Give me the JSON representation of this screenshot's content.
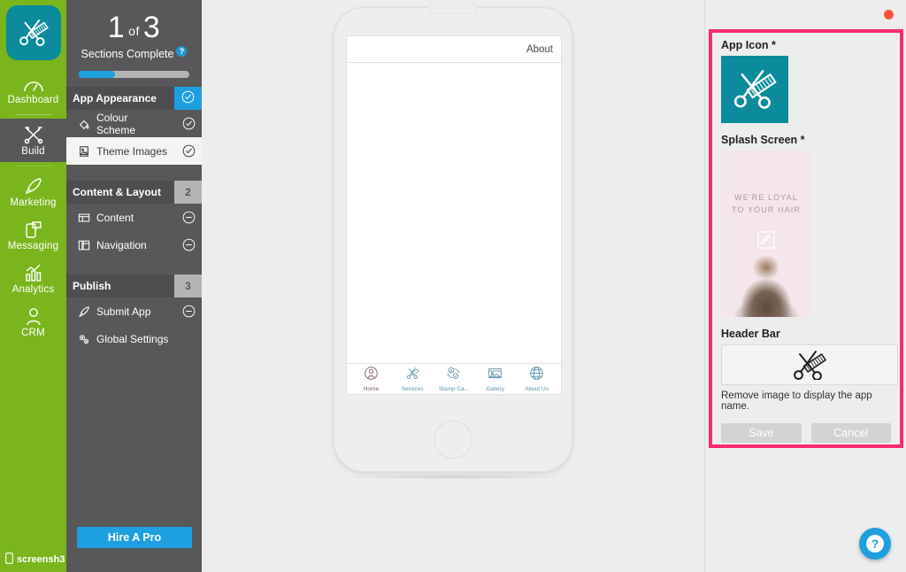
{
  "rail": {
    "logo_icon": "scissors-comb-logo",
    "items": [
      {
        "id": "dashboard",
        "label": "Dashboard",
        "icon": "gauge-icon",
        "active": false
      },
      {
        "id": "build",
        "label": "Build",
        "icon": "tools-icon",
        "active": true
      },
      {
        "id": "marketing",
        "label": "Marketing",
        "icon": "rocket-icon",
        "active": false
      },
      {
        "id": "messaging",
        "label": "Messaging",
        "icon": "chat-phone-icon",
        "active": false
      },
      {
        "id": "analytics",
        "label": "Analytics",
        "icon": "bar-chart-icon",
        "active": false
      },
      {
        "id": "crm",
        "label": "CRM",
        "icon": "person-icon",
        "active": false
      }
    ],
    "footer": {
      "label": "screensh3",
      "icon": "mobile-icon"
    }
  },
  "panel": {
    "progress": {
      "current": "1",
      "of": "of",
      "total": "3",
      "label": "Sections Complete",
      "help_icon": "question-mark-icon",
      "percent": 33
    },
    "groups": [
      {
        "id": "app-appearance",
        "title": "App Appearance",
        "badge": "✓",
        "badge_type": "done",
        "items": [
          {
            "id": "colour-scheme",
            "label": "Colour Scheme",
            "icon": "paint-drop-icon",
            "state": "check-circle-icon",
            "selected": false
          },
          {
            "id": "theme-images",
            "label": "Theme Images",
            "icon": "image-icon",
            "state": "check-circle-icon",
            "selected": true
          }
        ]
      },
      {
        "id": "content-layout",
        "title": "Content & Layout",
        "badge": "2",
        "badge_type": "num",
        "items": [
          {
            "id": "content",
            "label": "Content",
            "icon": "layout-icon",
            "state": "minus-circle-icon",
            "selected": false
          },
          {
            "id": "navigation",
            "label": "Navigation",
            "icon": "columns-icon",
            "state": "minus-circle-icon",
            "selected": false
          }
        ]
      },
      {
        "id": "publish",
        "title": "Publish",
        "badge": "3",
        "badge_type": "num",
        "items": [
          {
            "id": "submit-app",
            "label": "Submit App",
            "icon": "rocket-icon",
            "state": "minus-circle-icon",
            "selected": false
          },
          {
            "id": "global-settings",
            "label": "Global Settings",
            "icon": "gears-icon",
            "state": "",
            "selected": false
          }
        ]
      }
    ],
    "hire_a_pro": "Hire A Pro"
  },
  "preview": {
    "header_title": "About",
    "tabs": [
      {
        "id": "home",
        "label": "Home",
        "icon": "person-circle-icon",
        "active": true
      },
      {
        "id": "services",
        "label": "Services",
        "icon": "scissors-comb-icon",
        "active": false
      },
      {
        "id": "stamp-card",
        "label": "Stamp Ca...",
        "icon": "stamp-card-icon",
        "active": false
      },
      {
        "id": "gallery",
        "label": "Gallery",
        "icon": "photo-icon",
        "active": false
      },
      {
        "id": "about-us",
        "label": "About Us",
        "icon": "globe-icon",
        "active": false
      }
    ]
  },
  "properties": {
    "rec_dot": "recording-indicator",
    "app_icon": {
      "label": "App Icon *",
      "icon": "scissors-comb-icon",
      "bg_color": "#0b8b9b"
    },
    "splash": {
      "label": "Splash Screen *",
      "line1": "WE'RE LOYAL",
      "line2": "TO YOUR HAIR",
      "edit_icon": "edit-square-icon",
      "bg_color": "#f4e6ea"
    },
    "header_bar": {
      "label": "Header Bar",
      "icon": "scissors-comb-icon",
      "hint": "Remove image to display the app name."
    },
    "buttons": {
      "save": "Save",
      "cancel": "Cancel"
    },
    "highlight_color": "#fa2b6e"
  },
  "help_fab": {
    "icon": "question-mark-icon",
    "label": "?"
  }
}
